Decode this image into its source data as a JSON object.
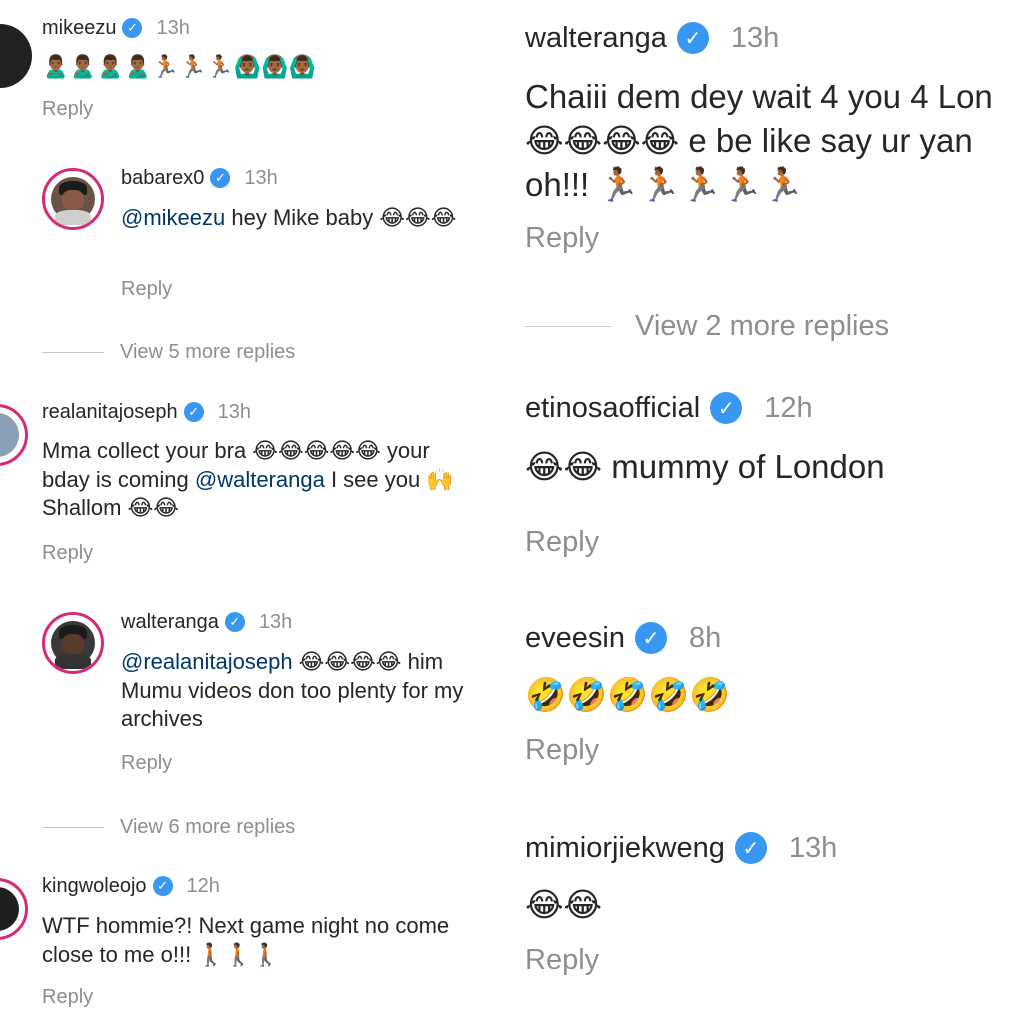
{
  "left": {
    "c1": {
      "username": "mikeezu",
      "time": "13h",
      "text": "🙎🏾‍♂️🙎🏾‍♂️🙎🏾‍♂️🙎🏾‍♂️🏃🏾🏃🏾🏃🏾🙆🏾‍♂️🙆🏾‍♂️🙆🏾‍♂️",
      "reply": "Reply"
    },
    "c2": {
      "username": "babarex0",
      "time": "13h",
      "mention": "@mikeezu",
      "text": " hey Mike baby 😂😂😂",
      "reply": "Reply"
    },
    "more1": "View 5 more replies",
    "c3": {
      "username": "realanitajoseph",
      "time": "13h",
      "text_a": "Mma collect your bra 😂😂😂😂😂 your bday is coming ",
      "mention": "@walteranga",
      "text_b": " I see you 🙌Shallom 😂😂",
      "reply": "Reply"
    },
    "c4": {
      "username": "walteranga",
      "time": "13h",
      "mention": "@realanitajoseph",
      "text": " 😂😂😂😂 him Mumu videos don too plenty for my archives",
      "reply": "Reply"
    },
    "more2": "View 6 more replies",
    "c5": {
      "username": "kingwoleojo",
      "time": "12h",
      "text": "WTF hommie?! Next game night no come close to me o!!! 🚶🏾🚶🏾🚶🏾",
      "reply": "Reply"
    }
  },
  "right": {
    "c1": {
      "username": "walteranga",
      "time": "13h",
      "line1": "Chaiii dem dey wait 4 you 4 Lon",
      "line2": "😂😂😂😂 e be like say ur yan",
      "line3": "oh!!! 🏃🏾🏃🏾🏃🏾🏃🏾🏃🏾",
      "reply": "Reply"
    },
    "more1": "View 2 more replies",
    "c2": {
      "username": "etinosaofficial",
      "time": "12h",
      "text": "😂😂 mummy of London",
      "reply": "Reply"
    },
    "c3": {
      "username": "eveesin",
      "time": "8h",
      "text": "🤣🤣🤣🤣🤣",
      "reply": "Reply"
    },
    "c4": {
      "username": "mimiorjiekweng",
      "time": "13h",
      "text": "😂😂",
      "reply": "Reply"
    }
  },
  "icons": {
    "verified": "verified-badge-icon",
    "check_glyph": "✓"
  },
  "colors": {
    "username": "#262626",
    "meta": "#8e8e8e",
    "mention": "#00376b",
    "verified": "#3897f0",
    "story_ring": "#d62976"
  }
}
